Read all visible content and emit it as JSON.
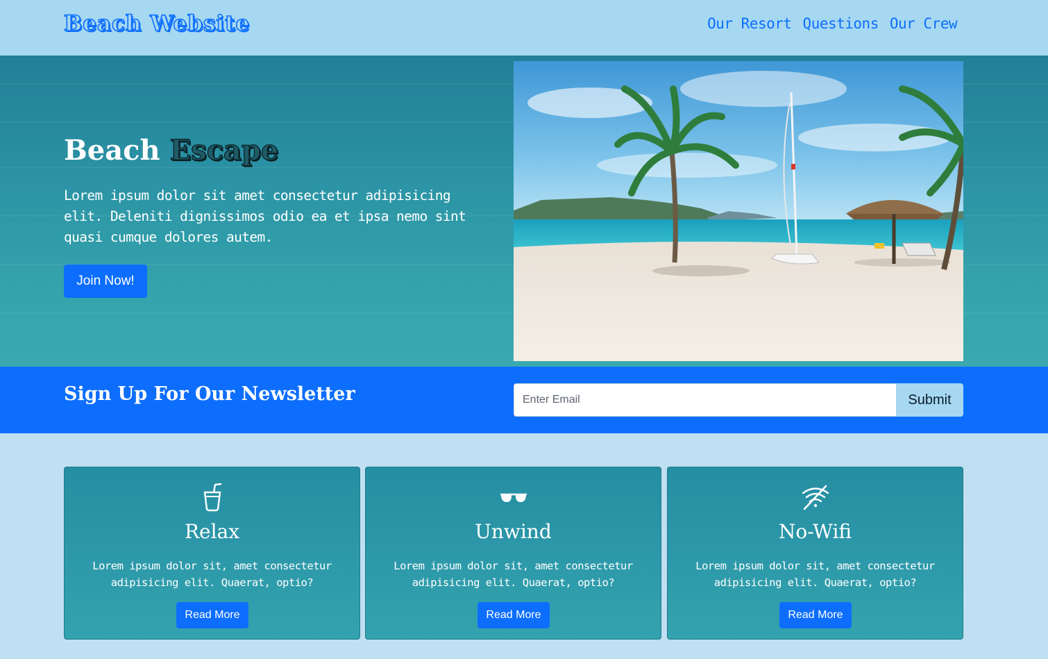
{
  "navbar": {
    "brand": "Beach Website",
    "links": [
      "Our Resort",
      "Questions",
      "Our Crew"
    ]
  },
  "hero": {
    "title_plain": "Beach",
    "title_accent": "Escape",
    "text": "Lorem ipsum dolor sit amet consectetur adipisicing elit. Deleniti dignissimos odio ea et ipsa nemo sint quasi cumque dolores autem.",
    "button": "Join Now!",
    "image": "beach-photo"
  },
  "newsletter": {
    "title": "Sign Up For Our Newsletter",
    "email_placeholder": "Enter Email",
    "submit": "Submit"
  },
  "cards": [
    {
      "icon": "cup-straw-icon",
      "title": "Relax",
      "text": "Lorem ipsum dolor sit, amet consectetur adipisicing elit. Quaerat, optio?",
      "button": "Read More"
    },
    {
      "icon": "sunglasses-icon",
      "title": "Unwind",
      "text": "Lorem ipsum dolor sit, amet consectetur adipisicing elit. Quaerat, optio?",
      "button": "Read More"
    },
    {
      "icon": "wifi-off-icon",
      "title": "No-Wifi",
      "text": "Lorem ipsum dolor sit, amet consectetur adipisicing elit. Quaerat, optio?",
      "button": "Read More"
    }
  ],
  "colors": {
    "primary": "#0d6efd",
    "light_blue": "#a6d8f1",
    "page_bg": "#c0dff2",
    "teal": "#2b93a5"
  }
}
